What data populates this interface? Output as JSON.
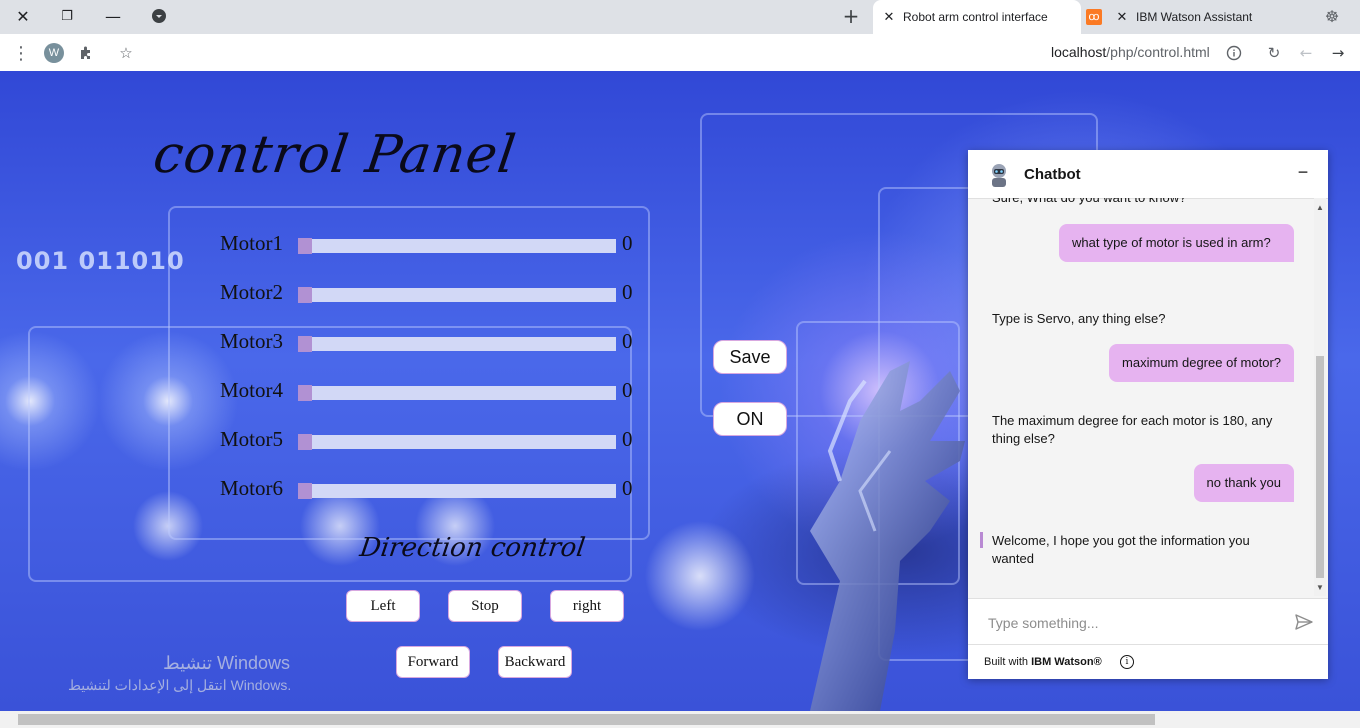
{
  "browser": {
    "tabs": [
      {
        "label": "Robot arm control interface",
        "active": true
      },
      {
        "label": "IBM Watson Assistant",
        "active": false
      }
    ],
    "url_host": "localhost",
    "url_path": "/php/control.html",
    "profile_initial": "W"
  },
  "background": {
    "binary_text": "001  011010"
  },
  "panel": {
    "title": "control Panel",
    "motors": [
      {
        "label": "Motor1",
        "value": "0",
        "level": 0
      },
      {
        "label": "Motor2",
        "value": "0",
        "level": 0
      },
      {
        "label": "Motor3",
        "value": "0",
        "level": 0
      },
      {
        "label": "Motor4",
        "value": "0",
        "level": 0
      },
      {
        "label": "Motor5",
        "value": "0",
        "level": 0
      },
      {
        "label": "Motor6",
        "value": "0",
        "level": 0
      }
    ],
    "save_label": "Save",
    "on_label": "ON",
    "direction_title": "Direction control",
    "buttons": {
      "left": "Left",
      "stop": "Stop",
      "right": "right",
      "forward": "Forward",
      "backward": "Backward"
    }
  },
  "watermark": {
    "line1": "تنشيط Windows",
    "line2": "انتقل إلى الإعدادات لتنشيط Windows."
  },
  "chat": {
    "title": "Chatbot",
    "messages": [
      {
        "from": "bot",
        "text": "Sure, What do you want to know?"
      },
      {
        "from": "user",
        "text": "what type of motor is used in arm?"
      },
      {
        "from": "bot",
        "text": "Type is Servo, any thing else?"
      },
      {
        "from": "user",
        "text": "maximum degree of motor?"
      },
      {
        "from": "bot",
        "text": "The maximum degree for each motor is 180, any thing else?"
      },
      {
        "from": "user",
        "text": "no thank you"
      },
      {
        "from": "bot",
        "text": "Welcome, I hope you got the information you wanted"
      }
    ],
    "input_placeholder": "Type something...",
    "footer_prefix": "Built with ",
    "footer_brand": "IBM Watson®"
  },
  "colors": {
    "slider_track": "#d2d8f6",
    "slider_thumb": "#b191d3",
    "user_bubble": "#e6b3f0"
  }
}
